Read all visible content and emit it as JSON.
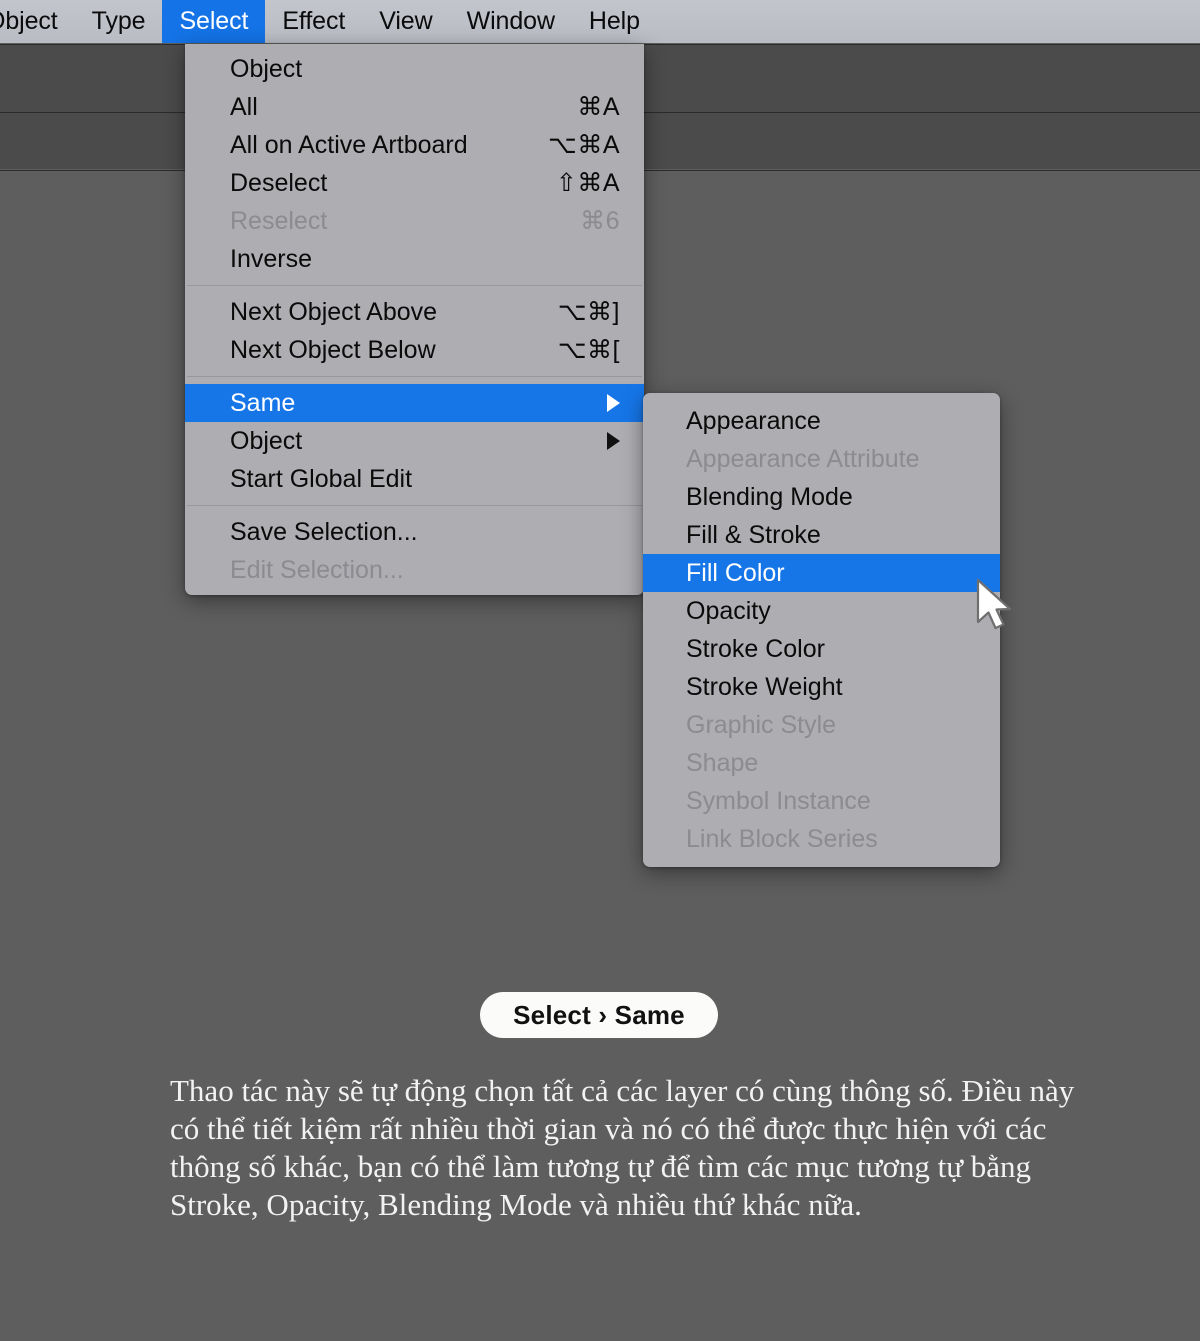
{
  "app": {
    "background_color": "#5e5e5e",
    "menu_panel_color": "#aeaeb2",
    "accent_color": "#1676e8"
  },
  "menubar": {
    "items": [
      {
        "label": "Object",
        "active": false,
        "clipped": true
      },
      {
        "label": "Type",
        "active": false,
        "clipped": false
      },
      {
        "label": "Select",
        "active": true,
        "clipped": false
      },
      {
        "label": "Effect",
        "active": false,
        "clipped": false
      },
      {
        "label": "View",
        "active": false,
        "clipped": false
      },
      {
        "label": "Window",
        "active": false,
        "clipped": false
      },
      {
        "label": "Help",
        "active": false,
        "clipped": false
      }
    ]
  },
  "select_menu": {
    "title": "Select",
    "groups": [
      {
        "items": [
          {
            "label": "Object",
            "shortcut": "",
            "disabled": false,
            "selected": false,
            "has_submenu": false
          },
          {
            "label": "All",
            "shortcut": "⌘A",
            "disabled": false,
            "selected": false,
            "has_submenu": false
          },
          {
            "label": "All on Active Artboard",
            "shortcut": "⌥⌘A",
            "disabled": false,
            "selected": false,
            "has_submenu": false
          },
          {
            "label": "Deselect",
            "shortcut": "⇧⌘A",
            "disabled": false,
            "selected": false,
            "has_submenu": false
          },
          {
            "label": "Reselect",
            "shortcut": "⌘6",
            "disabled": true,
            "selected": false,
            "has_submenu": false
          },
          {
            "label": "Inverse",
            "shortcut": "",
            "disabled": false,
            "selected": false,
            "has_submenu": false
          }
        ]
      },
      {
        "items": [
          {
            "label": "Next Object Above",
            "shortcut": "⌥⌘]",
            "disabled": false,
            "selected": false,
            "has_submenu": false
          },
          {
            "label": "Next Object Below",
            "shortcut": "⌥⌘[",
            "disabled": false,
            "selected": false,
            "has_submenu": false
          }
        ]
      },
      {
        "items": [
          {
            "label": "Same",
            "shortcut": "",
            "disabled": false,
            "selected": true,
            "has_submenu": true
          },
          {
            "label": "Object",
            "shortcut": "",
            "disabled": false,
            "selected": false,
            "has_submenu": true
          },
          {
            "label": "Start Global Edit",
            "shortcut": "",
            "disabled": false,
            "selected": false,
            "has_submenu": false
          }
        ]
      },
      {
        "items": [
          {
            "label": "Save Selection...",
            "shortcut": "",
            "disabled": false,
            "selected": false,
            "has_submenu": false
          },
          {
            "label": "Edit Selection...",
            "shortcut": "",
            "disabled": true,
            "selected": false,
            "has_submenu": false
          }
        ]
      }
    ]
  },
  "same_submenu": {
    "parent": "Same",
    "items": [
      {
        "label": "Appearance",
        "disabled": false,
        "selected": false
      },
      {
        "label": "Appearance Attribute",
        "disabled": true,
        "selected": false
      },
      {
        "label": "Blending Mode",
        "disabled": false,
        "selected": false
      },
      {
        "label": "Fill & Stroke",
        "disabled": false,
        "selected": false
      },
      {
        "label": "Fill Color",
        "disabled": false,
        "selected": true
      },
      {
        "label": "Opacity",
        "disabled": false,
        "selected": false
      },
      {
        "label": "Stroke Color",
        "disabled": false,
        "selected": false
      },
      {
        "label": "Stroke Weight",
        "disabled": false,
        "selected": false
      },
      {
        "label": "Graphic Style",
        "disabled": true,
        "selected": false
      },
      {
        "label": "Shape",
        "disabled": true,
        "selected": false
      },
      {
        "label": "Symbol Instance",
        "disabled": true,
        "selected": false
      },
      {
        "label": "Link Block Series",
        "disabled": true,
        "selected": false
      }
    ]
  },
  "badge": {
    "label": "Select › Same"
  },
  "caption": {
    "text": "Thao tác này sẽ tự động chọn tất cả các layer có cùng thông số. Điều này có thể tiết kiệm rất nhiều thời gian và nó có thể được thực hiện với các thông số khác, bạn có thể làm tương tự để tìm các mục tương tự bằng Stroke, Opacity, Blending Mode và nhiều thứ khác nữa."
  },
  "cursor": {
    "icon": "arrow-pointer-cursor"
  }
}
